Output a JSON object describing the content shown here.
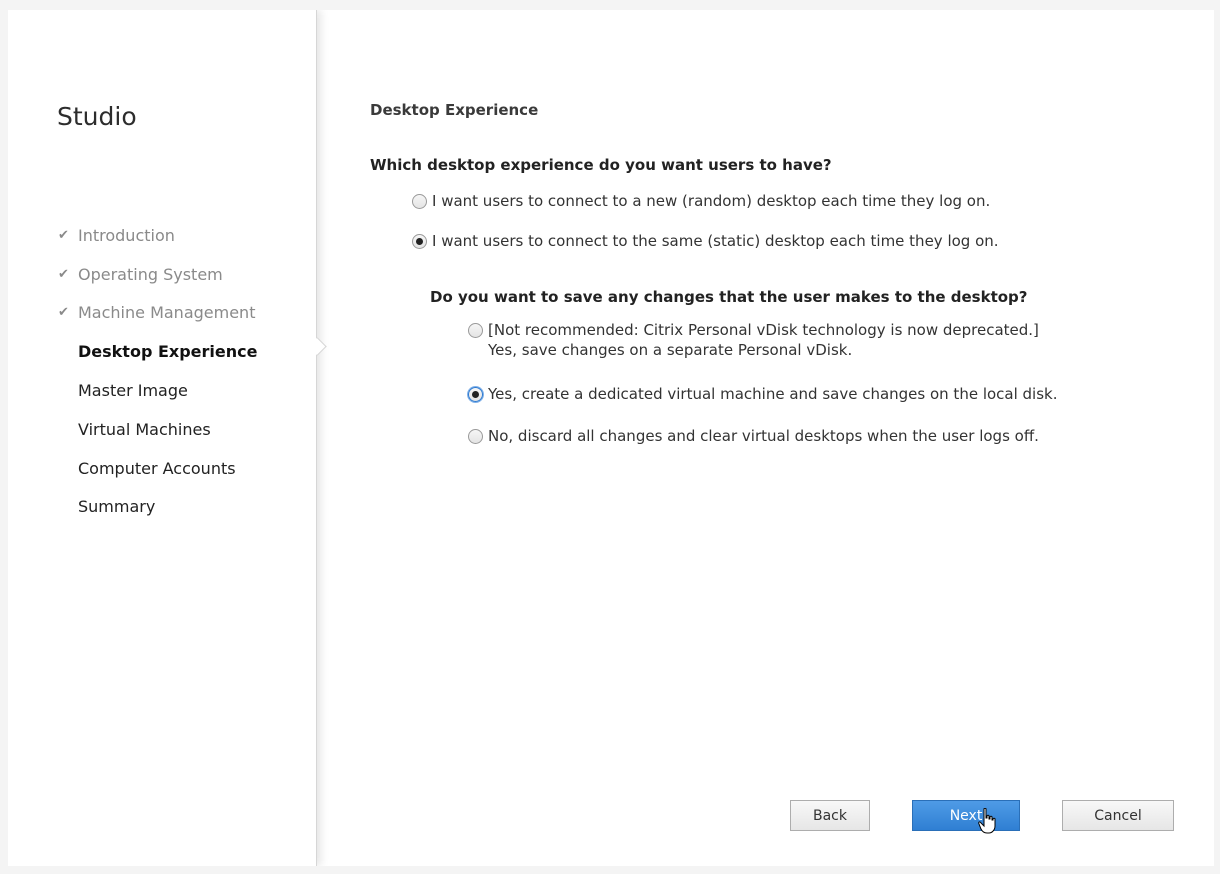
{
  "sidebar": {
    "title": "Studio",
    "items": [
      {
        "label": "Introduction",
        "state": "done"
      },
      {
        "label": "Operating System",
        "state": "done"
      },
      {
        "label": "Machine Management",
        "state": "done"
      },
      {
        "label": "Desktop Experience",
        "state": "current"
      },
      {
        "label": "Master Image",
        "state": "pending"
      },
      {
        "label": "Virtual Machines",
        "state": "pending"
      },
      {
        "label": "Computer Accounts",
        "state": "pending"
      },
      {
        "label": "Summary",
        "state": "pending"
      }
    ],
    "check_glyph": "✔"
  },
  "main": {
    "heading": "Desktop Experience",
    "question1": "Which desktop experience do you want users to have?",
    "question1_options": [
      {
        "label": "I want users to connect to a new (random) desktop each time they log on.",
        "selected": false
      },
      {
        "label": "I want users to connect to the same (static) desktop each time they log on.",
        "selected": true
      }
    ],
    "question2": "Do you want to save any changes that the user makes to the desktop?",
    "question2_options": [
      {
        "label_line1": "[Not recommended: Citrix Personal vDisk technology is now deprecated.]",
        "label_line2": "Yes, save changes on a separate Personal vDisk.",
        "selected": false
      },
      {
        "label": "Yes, create a dedicated virtual machine and save changes on the local disk.",
        "selected": true
      },
      {
        "label": "No, discard all changes and clear virtual desktops when the user logs off.",
        "selected": false
      }
    ]
  },
  "buttons": {
    "back": "Back",
    "next": "Next",
    "cancel": "Cancel"
  },
  "colors": {
    "next_button": "#2f7fd3",
    "done_step_text": "#8a8a8a"
  },
  "icons": {
    "step_done": "check-icon",
    "cursor": "pointer-cursor-icon"
  }
}
